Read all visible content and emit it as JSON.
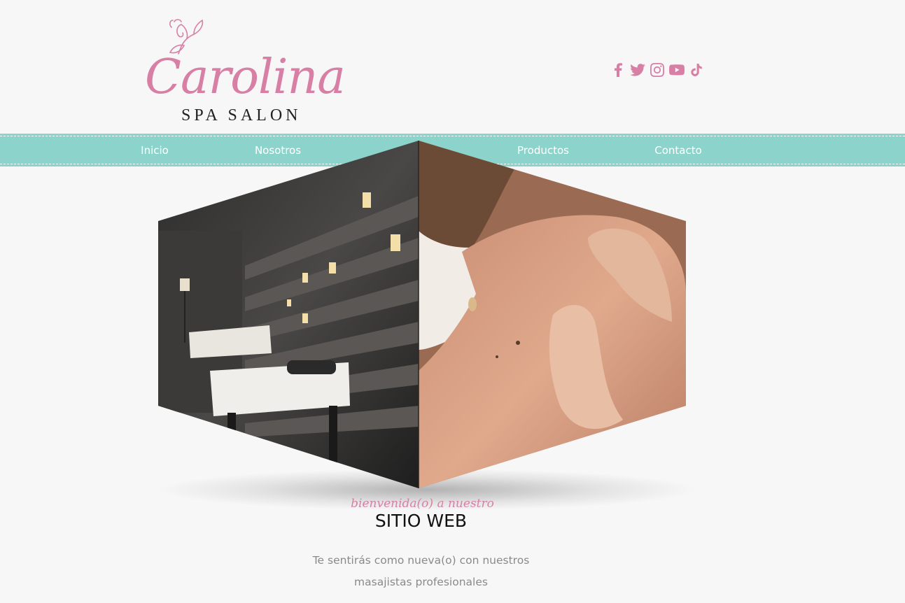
{
  "brand": {
    "name": "Carolina",
    "tagline": "SPA SALON",
    "color": "#d87fa5"
  },
  "social": [
    {
      "icon": "facebook-icon"
    },
    {
      "icon": "twitter-icon"
    },
    {
      "icon": "instagram-icon"
    },
    {
      "icon": "youtube-icon"
    },
    {
      "icon": "tiktok-icon"
    }
  ],
  "nav": {
    "background": "#8cd4cb",
    "items": [
      "Inicio",
      "Nosotros",
      "Productos",
      "Contacto"
    ]
  },
  "slider": {
    "faces": [
      "spa-room-photo",
      "massage-photo"
    ]
  },
  "welcome": {
    "script": "bienvenida(o) a nuestro",
    "title": "SITIO WEB",
    "text_line1": "Te sentirás como nueva(o) con nuestros",
    "text_line2": "masajistas profesionales"
  }
}
